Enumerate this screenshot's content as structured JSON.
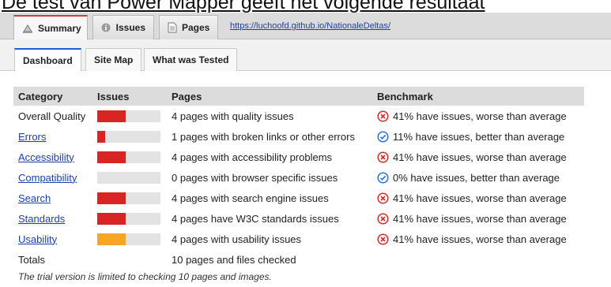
{
  "heading_text": "De test van Power Mapper geeft het volgende resultaat",
  "main_tabs": [
    {
      "label": "Summary",
      "icon": "summary-icon"
    },
    {
      "label": "Issues",
      "icon": "info-icon"
    },
    {
      "label": "Pages",
      "icon": "page-icon"
    }
  ],
  "url": "https://luchoofd.github.io/NationaleDeltas/",
  "sub_tabs": [
    {
      "label": "Dashboard"
    },
    {
      "label": "Site Map"
    },
    {
      "label": "What was Tested"
    }
  ],
  "table": {
    "headers": {
      "category": "Category",
      "issues": "Issues",
      "pages": "Pages",
      "benchmark": "Benchmark"
    },
    "rows": [
      {
        "category": "Overall Quality",
        "link": false,
        "fill": 0.45,
        "color": "#d92424",
        "pages": "4 pages with quality issues",
        "status": "bad",
        "benchmark": "41% have issues, worse than average"
      },
      {
        "category": "Errors",
        "link": true,
        "fill": 0.12,
        "color": "#d92424",
        "pages": "1 pages with broken links or other errors",
        "status": "good",
        "benchmark": "11% have issues, better than average"
      },
      {
        "category": "Accessibility",
        "link": true,
        "fill": 0.45,
        "color": "#d92424",
        "pages": "4 pages with accessibility problems",
        "status": "bad",
        "benchmark": "41% have issues, worse than average"
      },
      {
        "category": "Compatibility",
        "link": true,
        "fill": 0,
        "color": "#d92424",
        "pages": "0 pages with browser specific issues",
        "status": "good",
        "benchmark": "0% have issues, better than average"
      },
      {
        "category": "Search",
        "link": true,
        "fill": 0.45,
        "color": "#d92424",
        "pages": "4 pages with search engine issues",
        "status": "bad",
        "benchmark": "41% have issues, worse than average"
      },
      {
        "category": "Standards",
        "link": true,
        "fill": 0.45,
        "color": "#d92424",
        "pages": "4 pages have W3C standards issues",
        "status": "bad",
        "benchmark": "41% have issues, worse than average"
      },
      {
        "category": "Usability",
        "link": true,
        "fill": 0.45,
        "color": "#f5a623",
        "pages": "4 pages with usability issues",
        "status": "bad",
        "benchmark": "41% have issues, worse than average"
      }
    ],
    "totals": {
      "label": "Totals",
      "pages": "10 pages and files checked"
    }
  },
  "footnote": "The trial version is limited to checking 10 pages and images.",
  "colors": {
    "bad": "#d62b2b",
    "good": "#2f6fd6",
    "tab_active": "#d83b3b",
    "subtab_active": "#1f5fd1"
  }
}
